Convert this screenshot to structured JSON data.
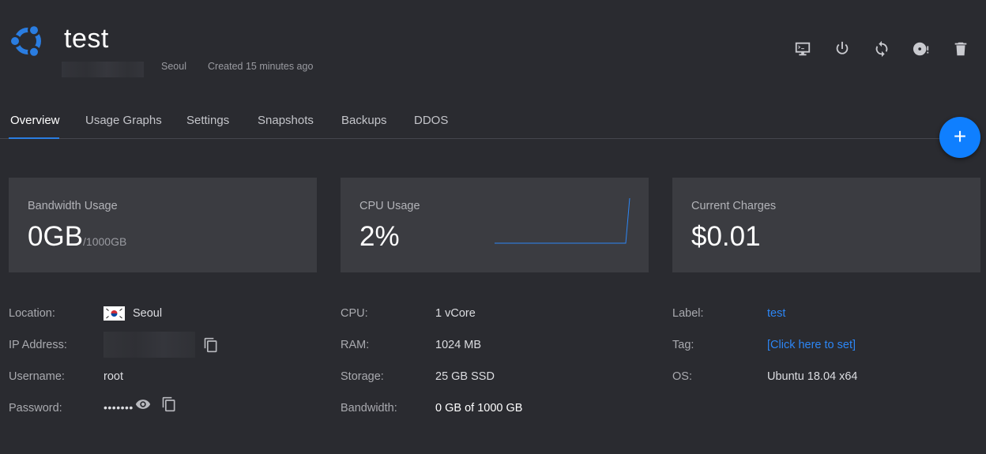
{
  "header": {
    "title": "test",
    "location": "Seoul",
    "created": "Created 15 minutes ago",
    "actions": [
      {
        "name": "console-icon"
      },
      {
        "name": "power-icon"
      },
      {
        "name": "restart-icon"
      },
      {
        "name": "reinstall-disk-icon"
      },
      {
        "name": "trash-icon"
      }
    ]
  },
  "tabs": [
    {
      "label": "Overview",
      "active": true
    },
    {
      "label": "Usage Graphs",
      "active": false
    },
    {
      "label": "Settings",
      "active": false
    },
    {
      "label": "Snapshots",
      "active": false
    },
    {
      "label": "Backups",
      "active": false
    },
    {
      "label": "DDOS",
      "active": false
    }
  ],
  "fab": {
    "label": "+"
  },
  "cards": {
    "bandwidth": {
      "label": "Bandwidth Usage",
      "value": "0GB",
      "sub": "/1000GB"
    },
    "cpu": {
      "label": "CPU Usage",
      "value": "2%"
    },
    "charges": {
      "label": "Current Charges",
      "value": "$0.01"
    }
  },
  "details": {
    "location": {
      "label": "Location:",
      "value": "Seoul"
    },
    "ip": {
      "label": "IP Address:"
    },
    "username": {
      "label": "Username:",
      "value": "root"
    },
    "password": {
      "label": "Password:",
      "value": "•••••••"
    },
    "cpu": {
      "label": "CPU:",
      "value": "1 vCore"
    },
    "ram": {
      "label": "RAM:",
      "value": "1024 MB"
    },
    "storage": {
      "label": "Storage:",
      "value": "25 GB SSD"
    },
    "bandwidth": {
      "label": "Bandwidth:",
      "value": "0 GB of 1000 GB"
    },
    "server_label": {
      "label": "Label:",
      "value": "test"
    },
    "tag": {
      "label": "Tag:",
      "value": "[Click here to set]"
    },
    "os": {
      "label": "OS:",
      "value": "Ubuntu 18.04 x64"
    }
  },
  "colors": {
    "background": "#2a2b30",
    "card": "#3b3c41",
    "accent": "#0f7fff",
    "link": "#2c86f5",
    "ubuntu_logo": "#2a7de1"
  }
}
